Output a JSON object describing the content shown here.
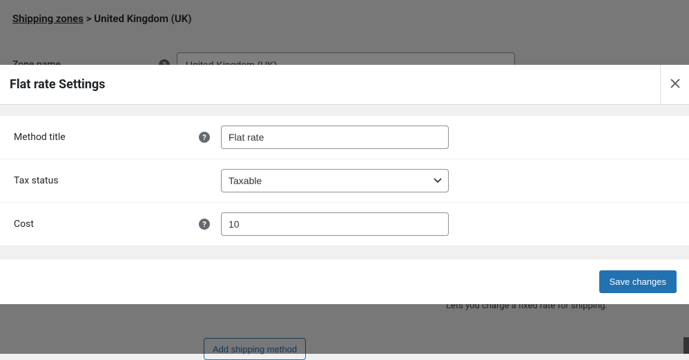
{
  "breadcrumb": {
    "root": "Shipping zones",
    "separator": ">",
    "current": "United Kingdom (UK)"
  },
  "bg_form": {
    "zone_name_label": "Zone name",
    "zone_name_value": "United Kingdom (UK)"
  },
  "bg_hint": "Lets you charge a fixed rate for shipping.",
  "bg_add_button": "Add shipping method",
  "modal": {
    "title": "Flat rate Settings",
    "fields": {
      "method_title": {
        "label": "Method title",
        "value": "Flat rate"
      },
      "tax_status": {
        "label": "Tax status",
        "value": "Taxable"
      },
      "cost": {
        "label": "Cost",
        "value": "10"
      }
    },
    "save_label": "Save changes"
  }
}
